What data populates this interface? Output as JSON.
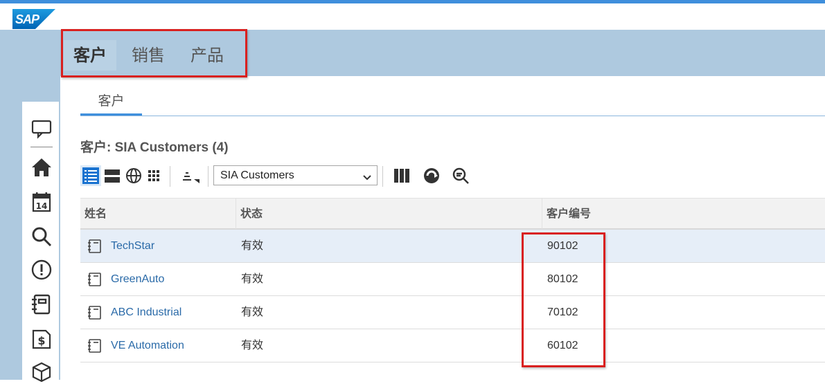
{
  "brand": {
    "logo_text": "SAP",
    "accent": "#3f8fdc",
    "band": "#aec9df",
    "highlight_border": "#d9201f"
  },
  "nav": {
    "tabs": [
      {
        "label": "客户",
        "active": true
      },
      {
        "label": "销售",
        "active": false
      },
      {
        "label": "产品",
        "active": false
      }
    ]
  },
  "subtab": {
    "label": "客户"
  },
  "list": {
    "title": "客户: SIA Customers (4)"
  },
  "toolbar": {
    "view_select": {
      "value": "SIA Customers"
    },
    "icons": [
      "list-view-icon",
      "table-view-icon",
      "globe-view-icon",
      "grid-view-icon",
      "sort-icon",
      "columns-icon",
      "refresh-icon",
      "zoom-icon"
    ]
  },
  "table": {
    "columns": [
      "姓名",
      "状态",
      "客户编号"
    ],
    "rows": [
      {
        "name": "TechStar",
        "status": "有效",
        "number": "90102"
      },
      {
        "name": "GreenAuto",
        "status": "有效",
        "number": "80102"
      },
      {
        "name": "ABC Industrial",
        "status": "有效",
        "number": "70102"
      },
      {
        "name": "VE Automation",
        "status": "有效",
        "number": "60102"
      }
    ]
  },
  "side_nav": {
    "icons": [
      "feed-icon",
      "home-icon",
      "calendar-icon",
      "search-icon",
      "alert-icon",
      "notebook-icon",
      "invoice-icon",
      "product-icon"
    ],
    "calendar_day": "14"
  }
}
